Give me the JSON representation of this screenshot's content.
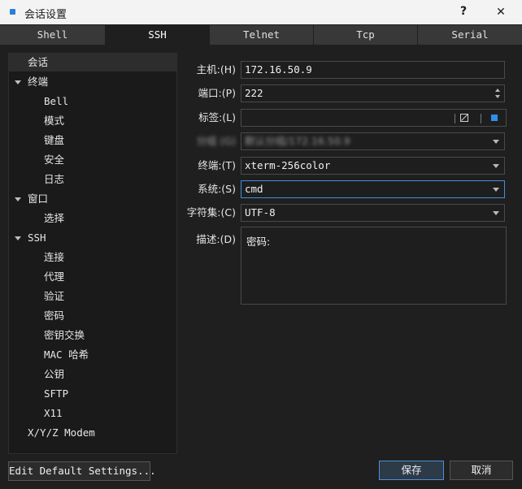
{
  "window": {
    "title": "会话设置",
    "help": "?",
    "close": "✕"
  },
  "tabs": [
    "Shell",
    "SSH",
    "Telnet",
    "Tcp",
    "Serial"
  ],
  "tree": [
    "会话",
    "终端",
    "Bell",
    "模式",
    "键盘",
    "安全",
    "日志",
    "窗口",
    "选择",
    "SSH",
    "连接",
    "代理",
    "验证",
    "密码",
    "密钥交换",
    "MAC 哈希",
    "公钥",
    "SFTP",
    "X11",
    "X/Y/Z Modem"
  ],
  "form": {
    "host_label": "主机:(H)",
    "host_value": "172.16.50.9",
    "port_label": "端口:(P)",
    "port_value": "222",
    "tag_label": "标签:(L)",
    "tag_value": "",
    "blurred_label": "分组 (G)",
    "blurred_value": "默认分组/172.16.50.9",
    "terminal_label": "终端:(T)",
    "terminal_value": "xterm-256color",
    "system_label": "系统:(S)",
    "system_value": "cmd",
    "charset_label": "字符集:(C)",
    "charset_value": "UTF-8",
    "desc_label": "描述:(D)",
    "desc_value": "密码:"
  },
  "buttons": {
    "edit_default": "Edit Default Settings...",
    "save": "保存",
    "cancel": "取消"
  },
  "colors": {
    "accent": "#2f8fe8",
    "background": "#1f1f1f"
  }
}
